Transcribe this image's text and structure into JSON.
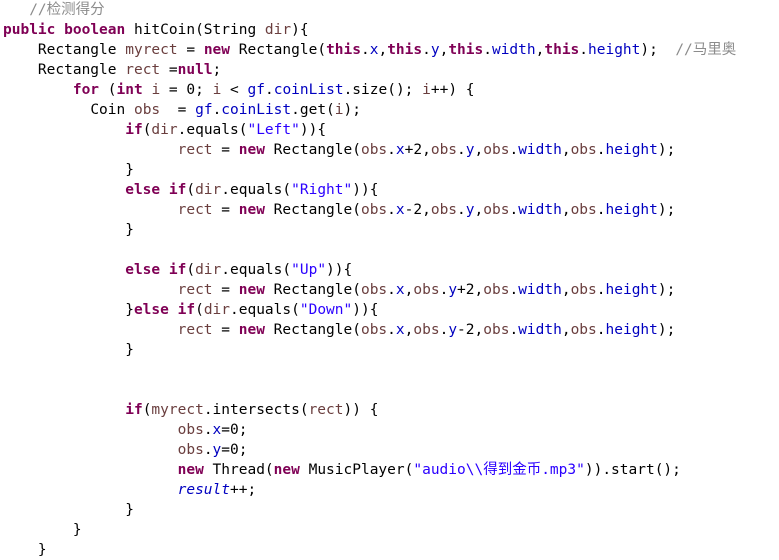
{
  "editor": {
    "language": "Java",
    "background_color": "#ffffff",
    "font_size_px": 14.5,
    "line_height_px": 20,
    "colors": {
      "plain": "#000000",
      "keyword": "#7f0055",
      "string": "#2a00ff",
      "comment": "#8c8c8c",
      "field": "#0000c0",
      "local": "#6a3e3e"
    }
  },
  "code": {
    "lines": [
      {
        "index": 1,
        "indent": 3,
        "text": "//检测得分",
        "tokens": [
          {
            "t": "//检测得分",
            "c": "comment"
          }
        ]
      },
      {
        "index": 2,
        "indent": 0,
        "text": "public boolean hitCoin(String dir){",
        "tokens": [
          {
            "t": "public",
            "c": "keyword"
          },
          {
            "t": " ",
            "c": "plain"
          },
          {
            "t": "boolean",
            "c": "keyword"
          },
          {
            "t": " hitCoin(String ",
            "c": "plain"
          },
          {
            "t": "dir",
            "c": "local"
          },
          {
            "t": "){",
            "c": "plain"
          }
        ]
      },
      {
        "index": 3,
        "indent": 4,
        "text": "Rectangle myrect = new Rectangle(this.x,this.y,this.width,this.height);  //马里奥",
        "tokens": [
          {
            "t": "Rectangle ",
            "c": "plain"
          },
          {
            "t": "myrect",
            "c": "local"
          },
          {
            "t": " = ",
            "c": "plain"
          },
          {
            "t": "new",
            "c": "keyword"
          },
          {
            "t": " Rectangle(",
            "c": "plain"
          },
          {
            "t": "this",
            "c": "keyword"
          },
          {
            "t": ".",
            "c": "plain"
          },
          {
            "t": "x",
            "c": "field"
          },
          {
            "t": ",",
            "c": "plain"
          },
          {
            "t": "this",
            "c": "keyword"
          },
          {
            "t": ".",
            "c": "plain"
          },
          {
            "t": "y",
            "c": "field"
          },
          {
            "t": ",",
            "c": "plain"
          },
          {
            "t": "this",
            "c": "keyword"
          },
          {
            "t": ".",
            "c": "plain"
          },
          {
            "t": "width",
            "c": "field"
          },
          {
            "t": ",",
            "c": "plain"
          },
          {
            "t": "this",
            "c": "keyword"
          },
          {
            "t": ".",
            "c": "plain"
          },
          {
            "t": "height",
            "c": "field"
          },
          {
            "t": ");  ",
            "c": "plain"
          },
          {
            "t": "//马里奥",
            "c": "comment"
          }
        ]
      },
      {
        "index": 4,
        "indent": 4,
        "text": "Rectangle rect =null;",
        "tokens": [
          {
            "t": "Rectangle ",
            "c": "plain"
          },
          {
            "t": "rect",
            "c": "local"
          },
          {
            "t": " =",
            "c": "plain"
          },
          {
            "t": "null",
            "c": "keyword"
          },
          {
            "t": ";",
            "c": "plain"
          }
        ]
      },
      {
        "index": 5,
        "indent": 8,
        "text": "for (int i = 0; i < gf.coinList.size(); i++) {",
        "tokens": [
          {
            "t": "for",
            "c": "keyword"
          },
          {
            "t": " (",
            "c": "plain"
          },
          {
            "t": "int",
            "c": "keyword"
          },
          {
            "t": " ",
            "c": "plain"
          },
          {
            "t": "i",
            "c": "local"
          },
          {
            "t": " = 0; ",
            "c": "plain"
          },
          {
            "t": "i",
            "c": "local"
          },
          {
            "t": " < ",
            "c": "plain"
          },
          {
            "t": "gf",
            "c": "field"
          },
          {
            "t": ".",
            "c": "plain"
          },
          {
            "t": "coinList",
            "c": "field"
          },
          {
            "t": ".size(); ",
            "c": "plain"
          },
          {
            "t": "i",
            "c": "local"
          },
          {
            "t": "++) {",
            "c": "plain"
          }
        ]
      },
      {
        "index": 6,
        "indent": 10,
        "text": "Coin obs  = gf.coinList.get(i);",
        "tokens": [
          {
            "t": "Coin ",
            "c": "plain"
          },
          {
            "t": "obs",
            "c": "local"
          },
          {
            "t": "  = ",
            "c": "plain"
          },
          {
            "t": "gf",
            "c": "field"
          },
          {
            "t": ".",
            "c": "plain"
          },
          {
            "t": "coinList",
            "c": "field"
          },
          {
            "t": ".get(",
            "c": "plain"
          },
          {
            "t": "i",
            "c": "local"
          },
          {
            "t": ");",
            "c": "plain"
          }
        ]
      },
      {
        "index": 7,
        "indent": 14,
        "text": "if(dir.equals(\"Left\")){",
        "tokens": [
          {
            "t": "if",
            "c": "keyword"
          },
          {
            "t": "(",
            "c": "plain"
          },
          {
            "t": "dir",
            "c": "local"
          },
          {
            "t": ".equals(",
            "c": "plain"
          },
          {
            "t": "\"Left\"",
            "c": "string"
          },
          {
            "t": ")){",
            "c": "plain"
          }
        ]
      },
      {
        "index": 8,
        "indent": 20,
        "text": "rect = new Rectangle(obs.x+2,obs.y,obs.width,obs.height);",
        "tokens": [
          {
            "t": "rect",
            "c": "local"
          },
          {
            "t": " = ",
            "c": "plain"
          },
          {
            "t": "new",
            "c": "keyword"
          },
          {
            "t": " Rectangle(",
            "c": "plain"
          },
          {
            "t": "obs",
            "c": "local"
          },
          {
            "t": ".",
            "c": "plain"
          },
          {
            "t": "x",
            "c": "field"
          },
          {
            "t": "+2,",
            "c": "plain"
          },
          {
            "t": "obs",
            "c": "local"
          },
          {
            "t": ".",
            "c": "plain"
          },
          {
            "t": "y",
            "c": "field"
          },
          {
            "t": ",",
            "c": "plain"
          },
          {
            "t": "obs",
            "c": "local"
          },
          {
            "t": ".",
            "c": "plain"
          },
          {
            "t": "width",
            "c": "field"
          },
          {
            "t": ",",
            "c": "plain"
          },
          {
            "t": "obs",
            "c": "local"
          },
          {
            "t": ".",
            "c": "plain"
          },
          {
            "t": "height",
            "c": "field"
          },
          {
            "t": ");",
            "c": "plain"
          }
        ]
      },
      {
        "index": 9,
        "indent": 14,
        "text": "}",
        "tokens": [
          {
            "t": "}",
            "c": "plain"
          }
        ]
      },
      {
        "index": 10,
        "indent": 14,
        "text": "else if(dir.equals(\"Right\")){",
        "tokens": [
          {
            "t": "else",
            "c": "keyword"
          },
          {
            "t": " ",
            "c": "plain"
          },
          {
            "t": "if",
            "c": "keyword"
          },
          {
            "t": "(",
            "c": "plain"
          },
          {
            "t": "dir",
            "c": "local"
          },
          {
            "t": ".equals(",
            "c": "plain"
          },
          {
            "t": "\"Right\"",
            "c": "string"
          },
          {
            "t": ")){",
            "c": "plain"
          }
        ]
      },
      {
        "index": 11,
        "indent": 20,
        "text": "rect = new Rectangle(obs.x-2,obs.y,obs.width,obs.height);",
        "tokens": [
          {
            "t": "rect",
            "c": "local"
          },
          {
            "t": " = ",
            "c": "plain"
          },
          {
            "t": "new",
            "c": "keyword"
          },
          {
            "t": " Rectangle(",
            "c": "plain"
          },
          {
            "t": "obs",
            "c": "local"
          },
          {
            "t": ".",
            "c": "plain"
          },
          {
            "t": "x",
            "c": "field"
          },
          {
            "t": "-2,",
            "c": "plain"
          },
          {
            "t": "obs",
            "c": "local"
          },
          {
            "t": ".",
            "c": "plain"
          },
          {
            "t": "y",
            "c": "field"
          },
          {
            "t": ",",
            "c": "plain"
          },
          {
            "t": "obs",
            "c": "local"
          },
          {
            "t": ".",
            "c": "plain"
          },
          {
            "t": "width",
            "c": "field"
          },
          {
            "t": ",",
            "c": "plain"
          },
          {
            "t": "obs",
            "c": "local"
          },
          {
            "t": ".",
            "c": "plain"
          },
          {
            "t": "height",
            "c": "field"
          },
          {
            "t": ");",
            "c": "plain"
          }
        ]
      },
      {
        "index": 12,
        "indent": 14,
        "text": "}",
        "tokens": [
          {
            "t": "}",
            "c": "plain"
          }
        ]
      },
      {
        "index": 13,
        "indent": 0,
        "text": "",
        "tokens": []
      },
      {
        "index": 14,
        "indent": 14,
        "text": "else if(dir.equals(\"Up\")){",
        "tokens": [
          {
            "t": "else",
            "c": "keyword"
          },
          {
            "t": " ",
            "c": "plain"
          },
          {
            "t": "if",
            "c": "keyword"
          },
          {
            "t": "(",
            "c": "plain"
          },
          {
            "t": "dir",
            "c": "local"
          },
          {
            "t": ".equals(",
            "c": "plain"
          },
          {
            "t": "\"Up\"",
            "c": "string"
          },
          {
            "t": ")){",
            "c": "plain"
          }
        ]
      },
      {
        "index": 15,
        "indent": 20,
        "text": "rect = new Rectangle(obs.x,obs.y+2,obs.width,obs.height);",
        "tokens": [
          {
            "t": "rect",
            "c": "local"
          },
          {
            "t": " = ",
            "c": "plain"
          },
          {
            "t": "new",
            "c": "keyword"
          },
          {
            "t": " Rectangle(",
            "c": "plain"
          },
          {
            "t": "obs",
            "c": "local"
          },
          {
            "t": ".",
            "c": "plain"
          },
          {
            "t": "x",
            "c": "field"
          },
          {
            "t": ",",
            "c": "plain"
          },
          {
            "t": "obs",
            "c": "local"
          },
          {
            "t": ".",
            "c": "plain"
          },
          {
            "t": "y",
            "c": "field"
          },
          {
            "t": "+2,",
            "c": "plain"
          },
          {
            "t": "obs",
            "c": "local"
          },
          {
            "t": ".",
            "c": "plain"
          },
          {
            "t": "width",
            "c": "field"
          },
          {
            "t": ",",
            "c": "plain"
          },
          {
            "t": "obs",
            "c": "local"
          },
          {
            "t": ".",
            "c": "plain"
          },
          {
            "t": "height",
            "c": "field"
          },
          {
            "t": ");",
            "c": "plain"
          }
        ]
      },
      {
        "index": 16,
        "indent": 14,
        "text": "}else if(dir.equals(\"Down\")){",
        "tokens": [
          {
            "t": "}",
            "c": "plain"
          },
          {
            "t": "else",
            "c": "keyword"
          },
          {
            "t": " ",
            "c": "plain"
          },
          {
            "t": "if",
            "c": "keyword"
          },
          {
            "t": "(",
            "c": "plain"
          },
          {
            "t": "dir",
            "c": "local"
          },
          {
            "t": ".equals(",
            "c": "plain"
          },
          {
            "t": "\"Down\"",
            "c": "string"
          },
          {
            "t": ")){",
            "c": "plain"
          }
        ]
      },
      {
        "index": 17,
        "indent": 20,
        "text": "rect = new Rectangle(obs.x,obs.y-2,obs.width,obs.height);",
        "tokens": [
          {
            "t": "rect",
            "c": "local"
          },
          {
            "t": " = ",
            "c": "plain"
          },
          {
            "t": "new",
            "c": "keyword"
          },
          {
            "t": " Rectangle(",
            "c": "plain"
          },
          {
            "t": "obs",
            "c": "local"
          },
          {
            "t": ".",
            "c": "plain"
          },
          {
            "t": "x",
            "c": "field"
          },
          {
            "t": ",",
            "c": "plain"
          },
          {
            "t": "obs",
            "c": "local"
          },
          {
            "t": ".",
            "c": "plain"
          },
          {
            "t": "y",
            "c": "field"
          },
          {
            "t": "-2,",
            "c": "plain"
          },
          {
            "t": "obs",
            "c": "local"
          },
          {
            "t": ".",
            "c": "plain"
          },
          {
            "t": "width",
            "c": "field"
          },
          {
            "t": ",",
            "c": "plain"
          },
          {
            "t": "obs",
            "c": "local"
          },
          {
            "t": ".",
            "c": "plain"
          },
          {
            "t": "height",
            "c": "field"
          },
          {
            "t": ");",
            "c": "plain"
          }
        ]
      },
      {
        "index": 18,
        "indent": 14,
        "text": "}",
        "tokens": [
          {
            "t": "}",
            "c": "plain"
          }
        ]
      },
      {
        "index": 19,
        "indent": 0,
        "text": "",
        "tokens": []
      },
      {
        "index": 20,
        "indent": 0,
        "text": "",
        "tokens": []
      },
      {
        "index": 21,
        "indent": 14,
        "text": "if(myrect.intersects(rect)) {",
        "tokens": [
          {
            "t": "if",
            "c": "keyword"
          },
          {
            "t": "(",
            "c": "plain"
          },
          {
            "t": "myrect",
            "c": "local"
          },
          {
            "t": ".intersects(",
            "c": "plain"
          },
          {
            "t": "rect",
            "c": "local"
          },
          {
            "t": ")) {",
            "c": "plain"
          }
        ]
      },
      {
        "index": 22,
        "indent": 20,
        "text": "obs.x=0;",
        "tokens": [
          {
            "t": "obs",
            "c": "local"
          },
          {
            "t": ".",
            "c": "plain"
          },
          {
            "t": "x",
            "c": "field"
          },
          {
            "t": "=0;",
            "c": "plain"
          }
        ]
      },
      {
        "index": 23,
        "indent": 20,
        "text": "obs.y=0;",
        "tokens": [
          {
            "t": "obs",
            "c": "local"
          },
          {
            "t": ".",
            "c": "plain"
          },
          {
            "t": "y",
            "c": "field"
          },
          {
            "t": "=0;",
            "c": "plain"
          }
        ]
      },
      {
        "index": 24,
        "indent": 20,
        "text": "new Thread(new MusicPlayer(\"audio\\\\得到金币.mp3\")).start();",
        "tokens": [
          {
            "t": "new",
            "c": "keyword"
          },
          {
            "t": " Thread(",
            "c": "plain"
          },
          {
            "t": "new",
            "c": "keyword"
          },
          {
            "t": " MusicPlayer(",
            "c": "plain"
          },
          {
            "t": "\"audio\\\\得到金币.mp3\"",
            "c": "string"
          },
          {
            "t": ")).start();",
            "c": "plain"
          }
        ]
      },
      {
        "index": 25,
        "indent": 20,
        "text": "result++;",
        "tokens": [
          {
            "t": "result",
            "c": "field-it"
          },
          {
            "t": "++;",
            "c": "plain"
          }
        ]
      },
      {
        "index": 26,
        "indent": 14,
        "text": "}",
        "tokens": [
          {
            "t": "}",
            "c": "plain"
          }
        ]
      },
      {
        "index": 27,
        "indent": 8,
        "text": "}",
        "tokens": [
          {
            "t": "}",
            "c": "plain"
          }
        ]
      },
      {
        "index": 28,
        "indent": 4,
        "text": "}",
        "tokens": [
          {
            "t": "}",
            "c": "plain"
          }
        ]
      }
    ]
  }
}
